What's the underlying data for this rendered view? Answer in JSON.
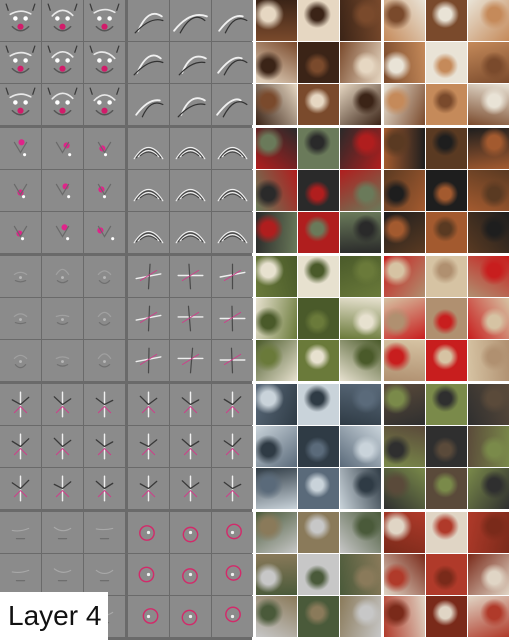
{
  "label": {
    "text": "Layer 4"
  },
  "left_panel": {
    "groups": 5,
    "columns": 2,
    "background": "#6a6a6a",
    "cell_background": "#8b8b8b",
    "patterns": [
      [
        "dog-face",
        "curve-stroke"
      ],
      [
        "blob",
        "concentric-arcs"
      ],
      [
        "faint-blob",
        "cross-stroke"
      ],
      [
        "bird-leg",
        "bird-leg"
      ],
      [
        "faint-stroke",
        "ring"
      ]
    ]
  },
  "right_panel": {
    "palettes": [
      [
        [
          "#7a4a2c",
          "#e6d7c2",
          "#3b2417"
        ],
        [
          "#c58a5a",
          "#7a4a2c",
          "#e9e3d6"
        ]
      ],
      [
        [
          "#b01e1e",
          "#6a7a5a",
          "#2a2a2a"
        ],
        [
          "#a35a2f",
          "#5a3a22",
          "#1e1e1e"
        ]
      ],
      [
        [
          "#6a7a3a",
          "#e7e1cf",
          "#4a5a2a"
        ],
        [
          "#c81e1e",
          "#d6c3a3",
          "#b09070"
        ]
      ],
      [
        [
          "#5a6a7a",
          "#c9d3da",
          "#2f3b45"
        ],
        [
          "#5a4a3a",
          "#7a8a4a",
          "#2f2f2f"
        ]
      ],
      [
        [
          "#4a5a3a",
          "#8a7a5a",
          "#c7c7c7"
        ],
        [
          "#7a2a1a",
          "#e0d5c5",
          "#b03a2a"
        ]
      ]
    ]
  }
}
